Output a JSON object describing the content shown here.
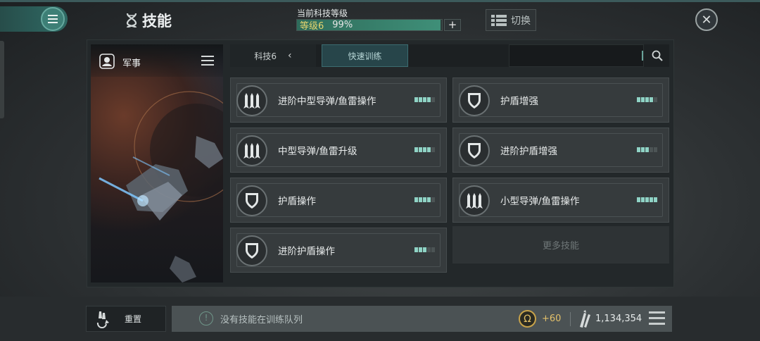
{
  "header": {
    "title": "技能",
    "title_icon": "dna-icon",
    "level_label": "当前科技等级",
    "level_badge": "等级6",
    "level_percent": "99%",
    "level_progress": 0.99,
    "plus_label": "+",
    "switch_label": "切换",
    "switch_icon": "grid-list-icon",
    "close_icon": "close-icon"
  },
  "category": {
    "name": "军事",
    "icon": "military-badge-icon"
  },
  "tabs": {
    "tech_label": "科技6",
    "back_icon": "chevron-left-icon",
    "quick_train_label": "快速训练"
  },
  "search": {
    "placeholder": "",
    "icon": "search-icon"
  },
  "skills": [
    {
      "name": "进阶中型导弹/鱼雷操作",
      "icon": "missile-icon",
      "level": 4,
      "max": 5
    },
    {
      "name": "护盾增强",
      "icon": "shield-icon",
      "level": 4,
      "max": 5
    },
    {
      "name": "中型导弹/鱼雷升级",
      "icon": "missile-icon",
      "level": 4,
      "max": 5
    },
    {
      "name": "进阶护盾增强",
      "icon": "shield-icon",
      "level": 3,
      "max": 5
    },
    {
      "name": "护盾操作",
      "icon": "shield-icon",
      "level": 4,
      "max": 5
    },
    {
      "name": "小型导弹/鱼雷操作",
      "icon": "missile-icon",
      "level": 5,
      "max": 5
    },
    {
      "name": "进阶护盾操作",
      "icon": "shield-icon",
      "level": 3,
      "max": 5
    }
  ],
  "more_skills_label": "更多技能",
  "bottom": {
    "reset_label": "重置",
    "reset_icon": "reset-missile-icon",
    "queue_info_icon": "info-icon",
    "queue_text": "没有技能在训练队列",
    "omega_symbol": "Ω",
    "omega_value": "+60",
    "skillpoints": "1,134,354",
    "skillpoints_icon": "skillpoint-missile-icon",
    "queue_menu_icon": "menu-icon"
  },
  "colors": {
    "accent": "#3f8f78",
    "level_on": "#8fd3c5",
    "level_off": "#4c5455",
    "level_badge": "#e6d56e",
    "omega": "#e2bf66"
  }
}
